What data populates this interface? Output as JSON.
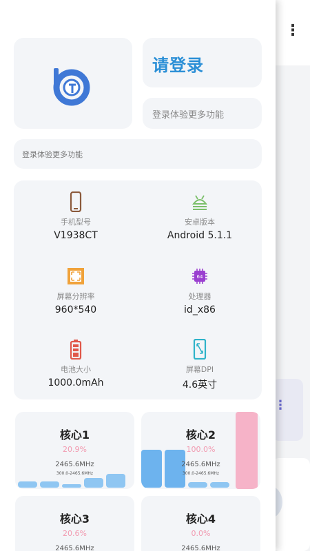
{
  "drawer": {
    "login_title": "请登录",
    "login_subtitle": "登录体验更多功能",
    "banner_text": "登录体验更多功能"
  },
  "device_info": [
    {
      "icon": "phone-icon",
      "label": "手机型号",
      "value": "V1938CT",
      "color": "#8b5a3c"
    },
    {
      "icon": "android-icon",
      "label": "安卓版本",
      "value": "Android 5.1.1",
      "color": "#7bbf6a"
    },
    {
      "icon": "resolution-icon",
      "label": "屏幕分辨率",
      "value": "960*540",
      "color": "#f0a23a"
    },
    {
      "icon": "cpu-icon",
      "label": "处理器",
      "value": "id_x86",
      "color": "#9a3fd0"
    },
    {
      "icon": "battery-icon",
      "label": "电池大小",
      "value": "1000.0mAh",
      "color": "#e0584a"
    },
    {
      "icon": "screen-dpi-icon",
      "label": "屏幕DPI",
      "value": "4.6英寸",
      "color": "#2fb3c9"
    }
  ],
  "cores": [
    {
      "title": "核心1",
      "usage": "20.9%",
      "freq": "2465.6MHz",
      "range": "300.0-2465.6MHz"
    },
    {
      "title": "核心2",
      "usage": "100.0%",
      "freq": "2465.6MHz",
      "range": "300.0-2465.6MHz"
    },
    {
      "title": "核心3",
      "usage": "20.6%",
      "freq": "2465.6MHz",
      "range": ""
    },
    {
      "title": "核心4",
      "usage": "0.0%",
      "freq": "2465.6MHz",
      "range": ""
    }
  ],
  "colors": {
    "accent": "#2b8fd6",
    "usage_text": "#f29ab0",
    "bar_blue": "#8fc6f2",
    "bar_pink": "#f6b3c8"
  }
}
